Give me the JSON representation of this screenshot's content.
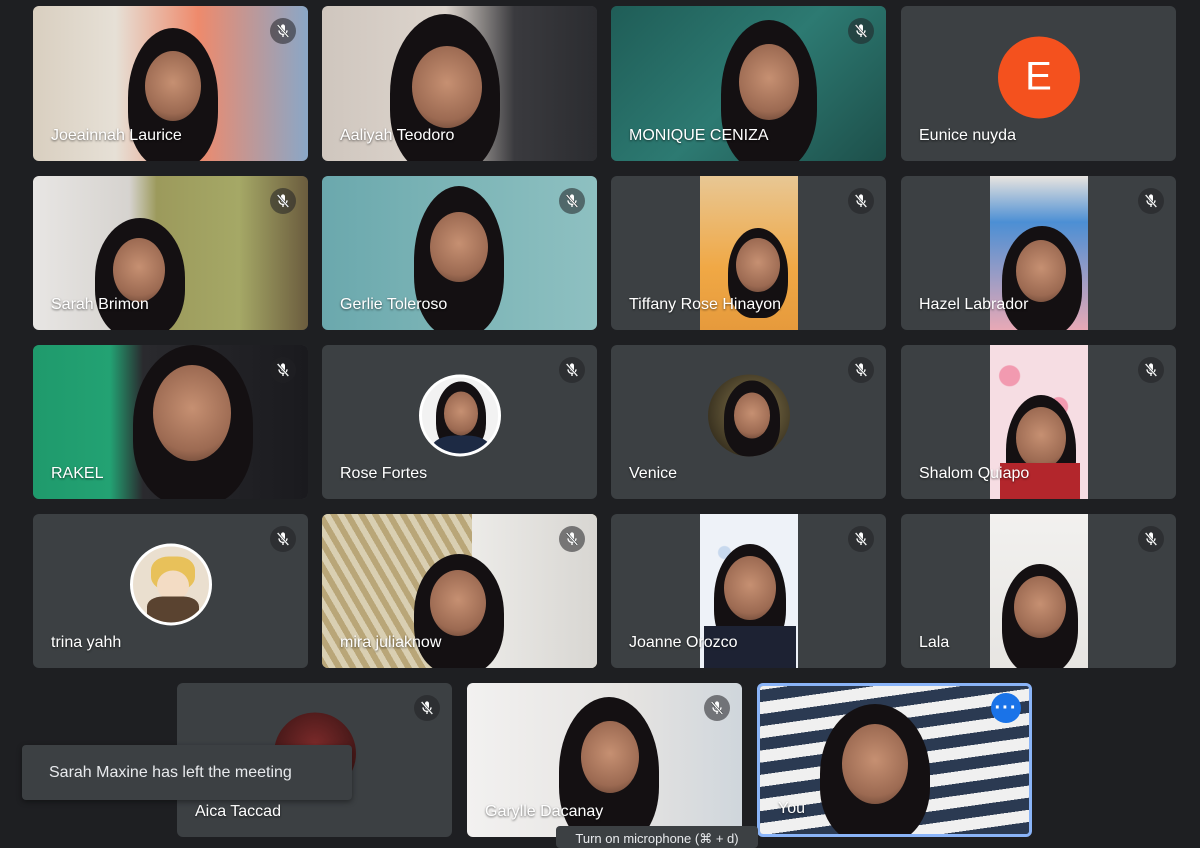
{
  "participants": [
    {
      "name": "Joeainnah Laurice",
      "muted": true
    },
    {
      "name": "Aaliyah Teodoro",
      "muted": false
    },
    {
      "name": "MONIQUE CENIZA",
      "muted": true
    },
    {
      "name": "Eunice nuyda",
      "muted": false,
      "avatar_letter": "E",
      "avatar_color": "#f4511e"
    },
    {
      "name": "Sarah Brimon",
      "muted": true
    },
    {
      "name": "Gerlie Toleroso",
      "muted": true
    },
    {
      "name": "Tiffany Rose Hinayon",
      "muted": true
    },
    {
      "name": "Hazel Labrador",
      "muted": true
    },
    {
      "name": "RAKEL",
      "muted": true
    },
    {
      "name": "Rose Fortes",
      "muted": true
    },
    {
      "name": "Venice",
      "muted": true
    },
    {
      "name": "Shalom Quiapo",
      "muted": true
    },
    {
      "name": "trina yahh",
      "muted": true
    },
    {
      "name": "mira juliaknow",
      "muted": true
    },
    {
      "name": "Joanne Orozco",
      "muted": true
    },
    {
      "name": "Lala",
      "muted": true
    },
    {
      "name": "Aica Taccad",
      "muted": true
    },
    {
      "name": "Garylle Dacanay",
      "muted": true
    },
    {
      "name": "You",
      "muted": false,
      "is_self": true,
      "more_icon": "more-horizontal-icon"
    }
  ],
  "notification": "Sarah Maxine has left the meeting",
  "tooltip": "Turn on microphone (⌘ + d)",
  "colors": {
    "tile_bg": "#3c4043",
    "self_border": "#8ab4f8",
    "more_button": "#1a73e8",
    "page_bg": "#1e1f22"
  }
}
